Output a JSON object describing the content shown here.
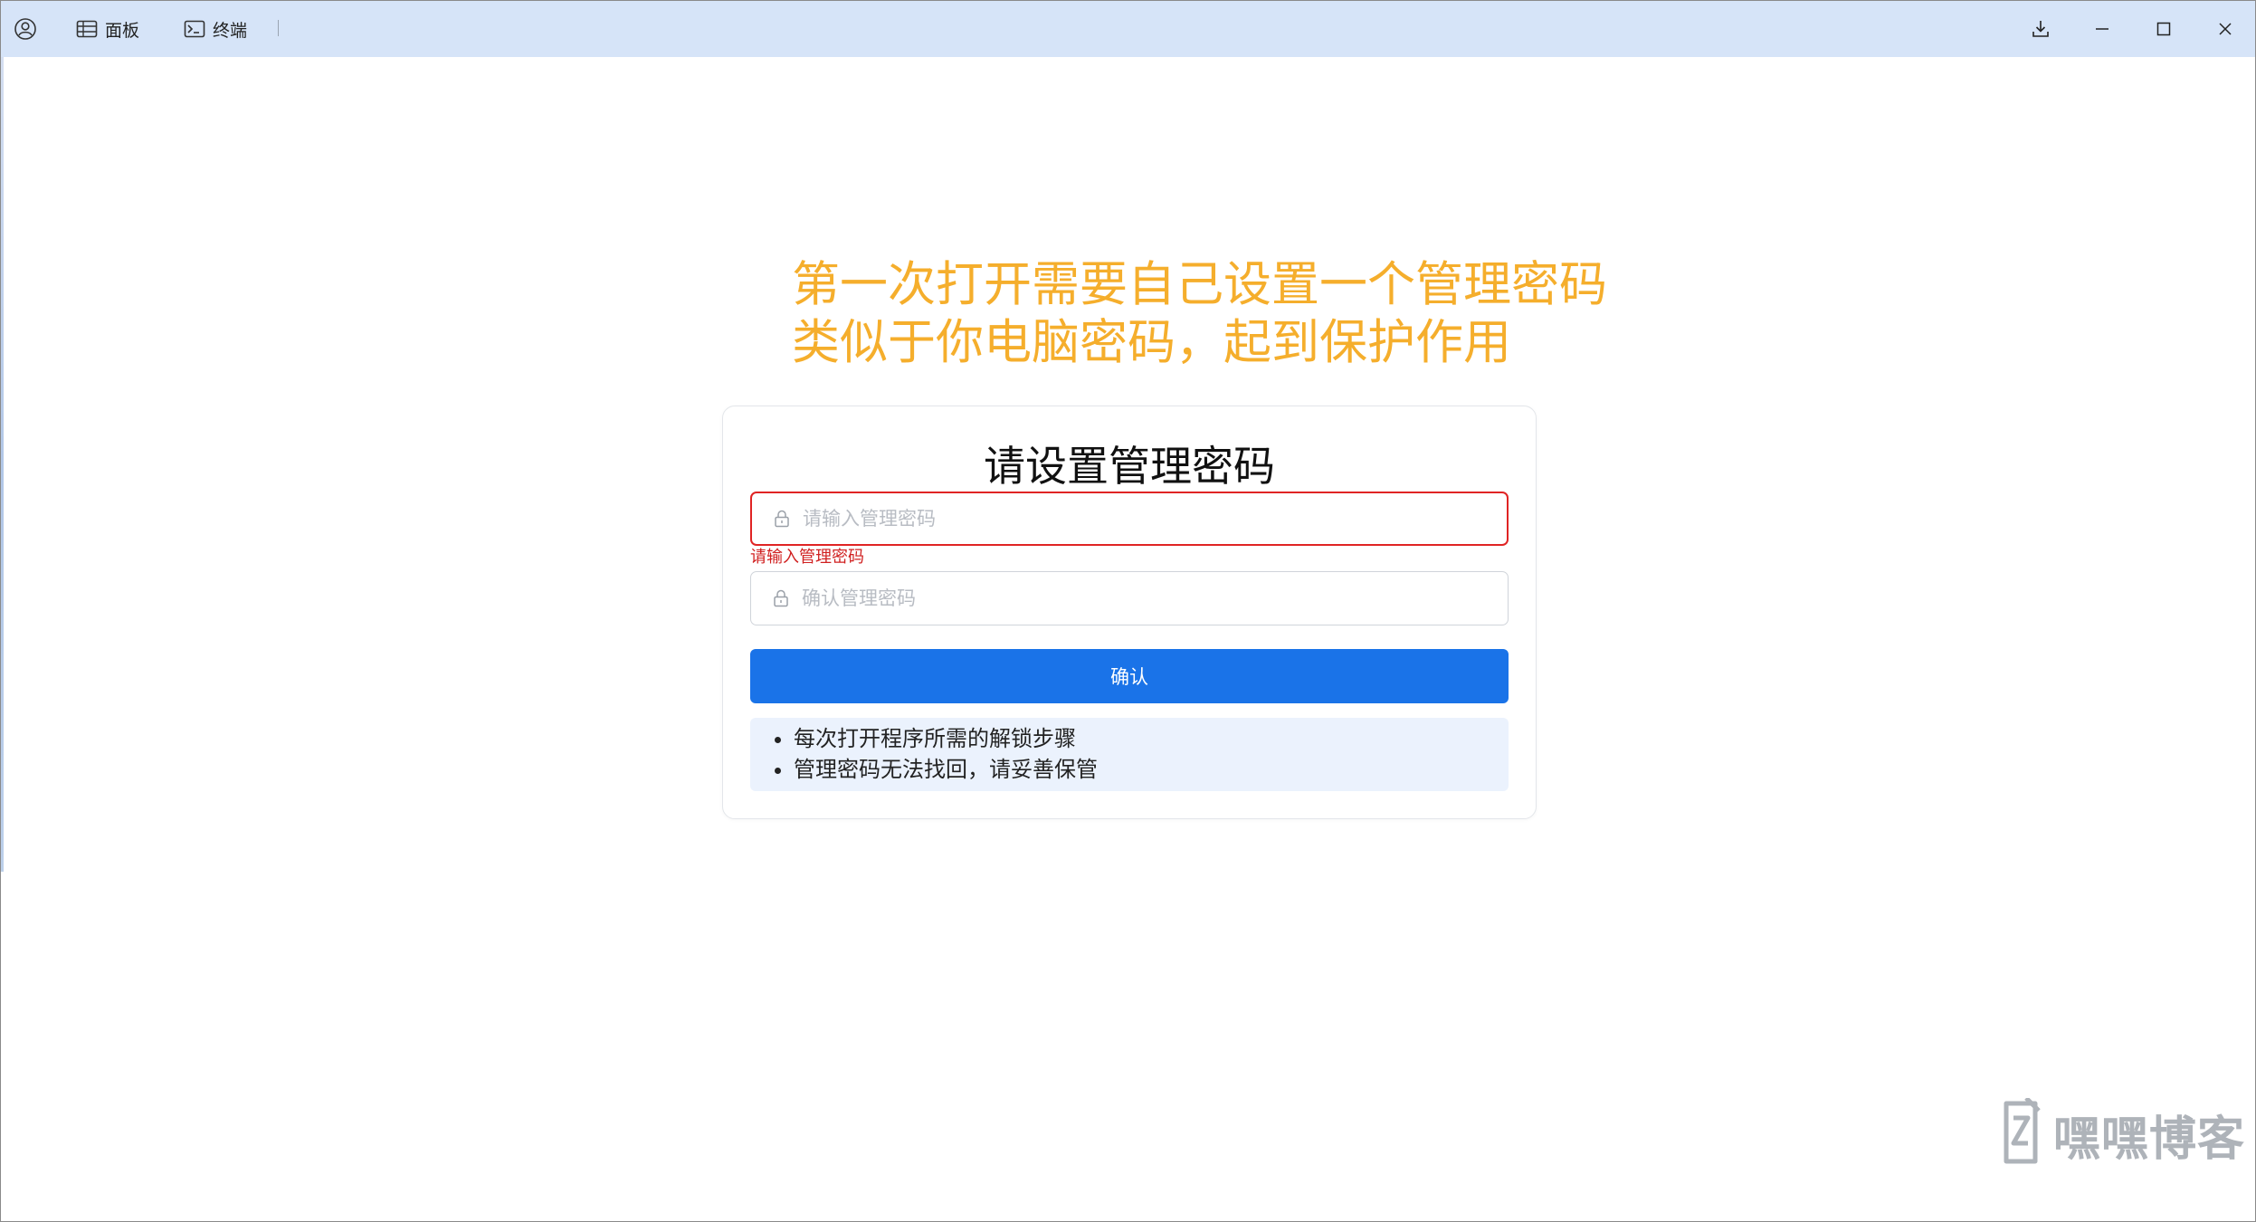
{
  "titlebar": {
    "panel_label": "面板",
    "terminal_label": "终端"
  },
  "annotation": {
    "line1": "第一次打开需要自己设置一个管理密码",
    "line2": "类似于你电脑密码，起到保护作用"
  },
  "card": {
    "title": "请设置管理密码",
    "password_placeholder": "请输入管理密码",
    "password_value": "",
    "password_error": "请输入管理密码",
    "confirm_placeholder": "确认管理密码",
    "confirm_value": "",
    "confirm_button": "确认",
    "tips": [
      "每次打开程序所需的解锁步骤",
      "管理密码无法找回，请妥善保管"
    ]
  },
  "watermark": {
    "text": "嘿嘿博客"
  },
  "colors": {
    "titlebar_bg": "#d6e4f8",
    "annotation": "#f5ae2c",
    "primary": "#1a73e8",
    "error": "#e02424",
    "tips_bg": "#ebf2fd"
  },
  "icons": {
    "avatar": "user-circle-icon",
    "panel": "table-icon",
    "terminal": "terminal-icon",
    "download": "download-icon",
    "minimize": "minimize-icon",
    "maximize": "maximize-icon",
    "close": "close-icon",
    "lock": "lock-icon"
  }
}
